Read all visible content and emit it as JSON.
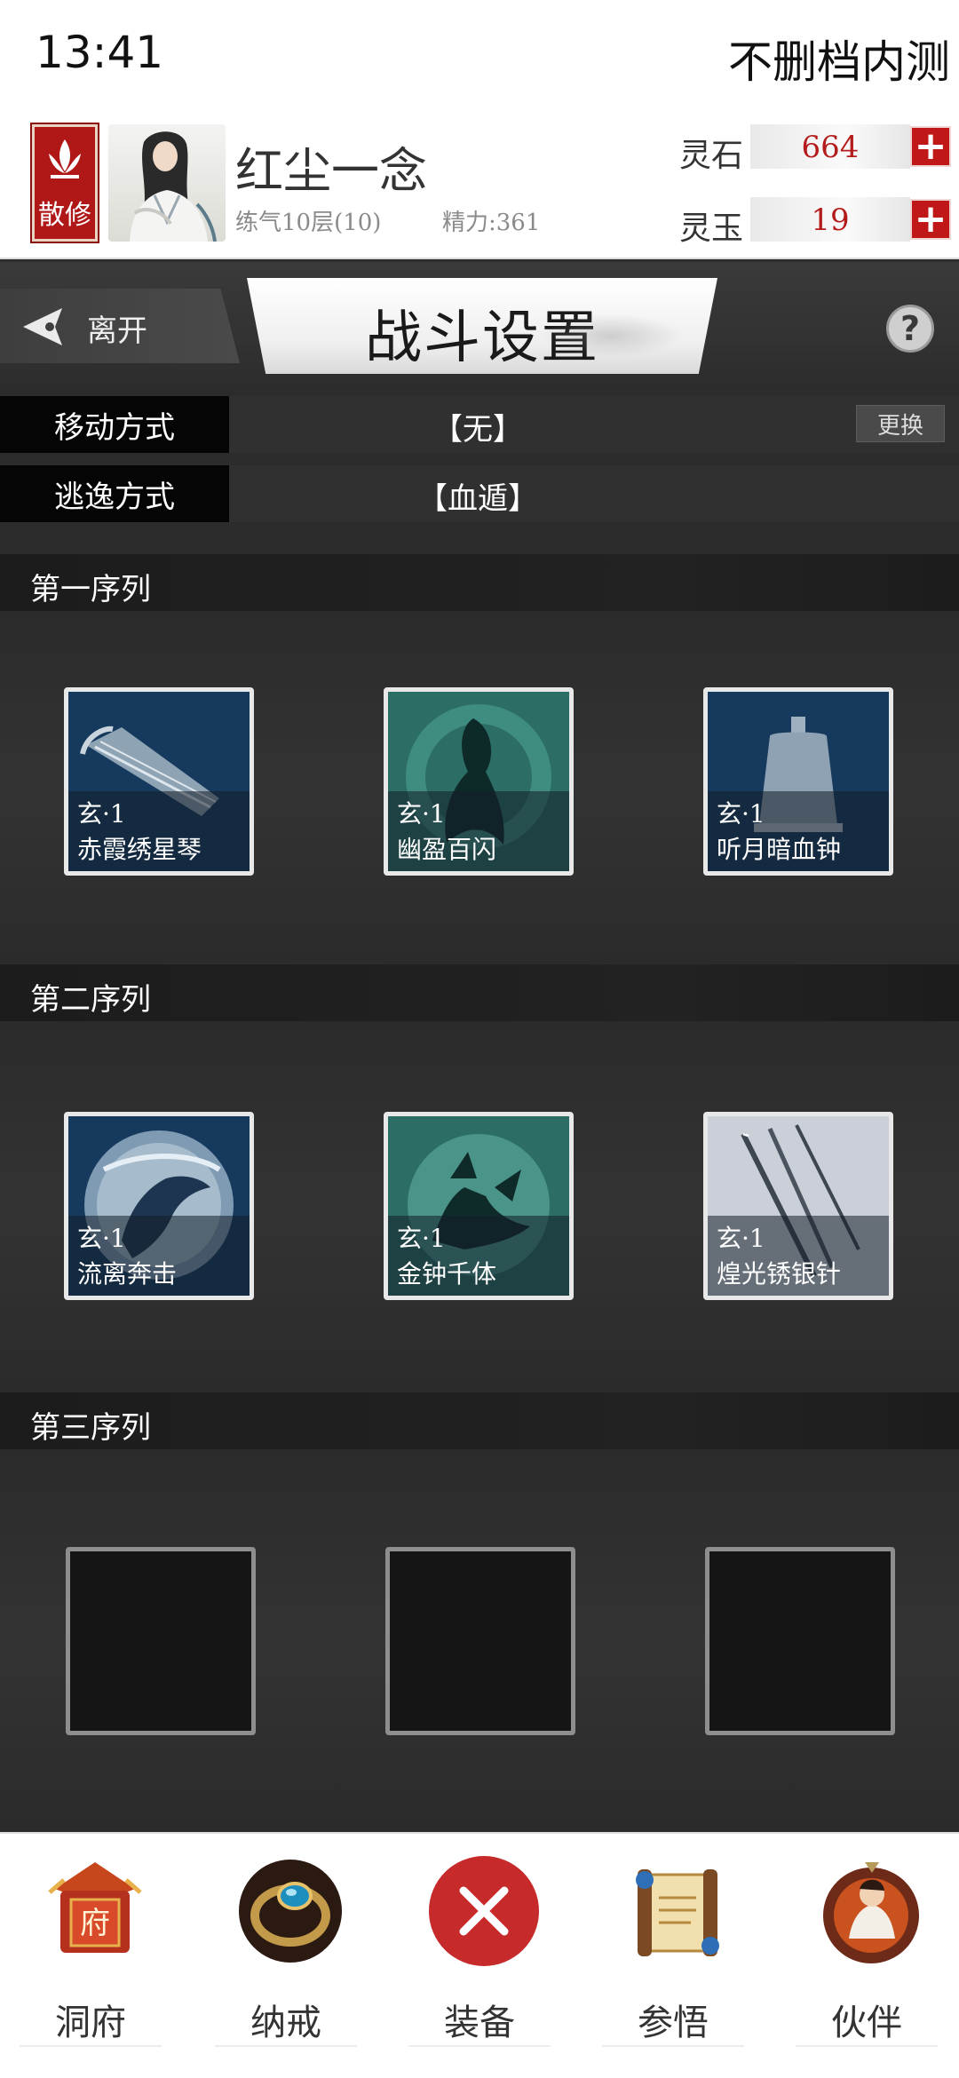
{
  "status_bar": {
    "time": "13:41",
    "app_title": "不删档内测"
  },
  "profile": {
    "sect": "散修",
    "name": "红尘一念",
    "level": "练气10层(10)",
    "energy": "精力:361",
    "currencies": [
      {
        "label": "灵石",
        "value": "664"
      },
      {
        "label": "灵玉",
        "value": "19"
      }
    ]
  },
  "title_bar": {
    "leave": "离开",
    "title": "战斗设置",
    "help": "?"
  },
  "settings": {
    "move": {
      "label": "移动方式",
      "value": "【无】",
      "change": "更换"
    },
    "escape": {
      "label": "逃逸方式",
      "value": "【血遁】"
    }
  },
  "sequences": [
    {
      "title": "第一序列",
      "skills": [
        {
          "grade": "玄·1",
          "name": "赤霞绣星琴"
        },
        {
          "grade": "玄·1",
          "name": "幽盈百闪"
        },
        {
          "grade": "玄·1",
          "name": "听月暗血钟"
        }
      ]
    },
    {
      "title": "第二序列",
      "skills": [
        {
          "grade": "玄·1",
          "name": "流离奔击"
        },
        {
          "grade": "玄·1",
          "name": "金钟千体"
        },
        {
          "grade": "玄·1",
          "name": "煌光锈银针"
        }
      ]
    },
    {
      "title": "第三序列",
      "skills": []
    }
  ],
  "bottom_nav": [
    {
      "label": "洞府",
      "icon": "cave-mansion-icon"
    },
    {
      "label": "纳戒",
      "icon": "storage-ring-icon"
    },
    {
      "label": "装备",
      "icon": "close-icon"
    },
    {
      "label": "参悟",
      "icon": "scroll-icon"
    },
    {
      "label": "伙伴",
      "icon": "companion-icon"
    }
  ],
  "colors": {
    "accent_red": "#c01818",
    "dark_bg": "#2c2c2c",
    "label_bg": "#050505"
  }
}
